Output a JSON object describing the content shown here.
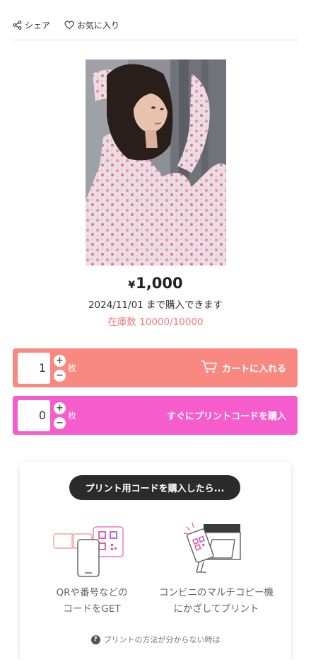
{
  "header": {
    "share_label": "シェア",
    "favorite_label": "お気に入り"
  },
  "product": {
    "image_icon": "photo-portrait",
    "price_currency": "¥",
    "price_value": "1,000",
    "deadline": "2024/11/01 まで購入できます",
    "stock": "在庫数 10000/10000"
  },
  "cart": {
    "quantity": "1",
    "plus": "+",
    "minus": "−",
    "unit": "枚",
    "button_label": "カートに入れる",
    "icon": "cart-icon",
    "color": "#f98880"
  },
  "print": {
    "quantity": "0",
    "plus": "+",
    "minus": "−",
    "unit": "枚",
    "button_label": "すぐにプリントコードを購入",
    "color": "#f55ccc"
  },
  "guide": {
    "heading": "プリント用コードを購入したら...",
    "step1_line1": "QRや番号などの",
    "step1_line2": "コードをGET",
    "step2_line1": "コンビニのマルチコピー機",
    "step2_line2": "にかざしてプリント",
    "help_text": "プリントの方法が分からない時は"
  }
}
